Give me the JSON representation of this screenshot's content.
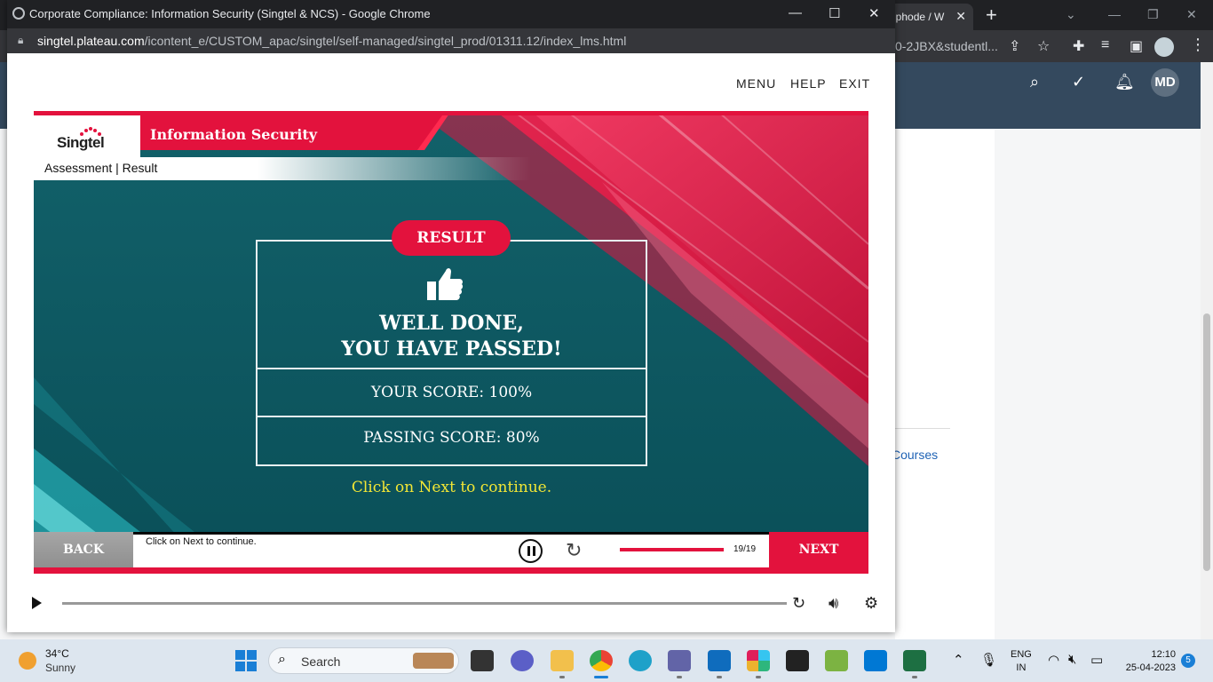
{
  "background_browser": {
    "tab_title": "iphode / W",
    "url_fragment": "0-2JBX&studentl...",
    "header_initials": "MD",
    "courses_link": "Courses"
  },
  "popup": {
    "window_title": "Corporate Compliance: Information Security (Singtel & NCS) - Google Chrome",
    "url_domain": "singtel.plateau.com",
    "url_path": "/icontent_e/CUSTOM_apac/singtel/self-managed/singtel_prod/01311.12/index_lms.html"
  },
  "lms_menu": {
    "menu": "MENU",
    "help": "HELP",
    "exit": "EXIT"
  },
  "course": {
    "logo_text": "Singtel",
    "title": "Information Security",
    "breadcrumb": "Assessment | Result"
  },
  "result": {
    "badge": "RESULT",
    "headline_line1": "WELL DONE,",
    "headline_line2": "YOU HAVE PASSED!",
    "your_score": "YOUR SCORE:  100%",
    "passing_score": "PASSING SCORE:  80%",
    "continue_text": "Click on Next to continue."
  },
  "navigation": {
    "back_label": "BACK",
    "next_label": "NEXT",
    "instruction": "Click on Next to continue.",
    "page_counter": "19/19",
    "progress_fraction": 1.0
  },
  "taskbar": {
    "temperature": "34°C",
    "condition": "Sunny",
    "search_label": "Search",
    "language_line1": "ENG",
    "language_line2": "IN",
    "time": "12:10",
    "date": "25-04-2023",
    "notification_count": "5"
  },
  "colors": {
    "brand_red": "#e3123d",
    "teal": "#0e5c66",
    "continue_yellow": "#f2e635"
  }
}
